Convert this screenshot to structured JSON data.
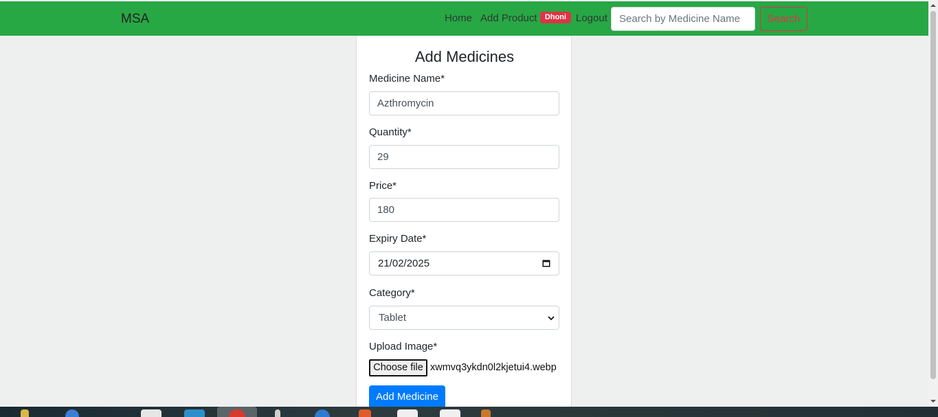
{
  "nav": {
    "brand": "MSA",
    "home": "Home",
    "add_product": "Add Product",
    "user_badge": "Dhoni",
    "logout": "Logout",
    "search_placeholder": "Search by Medicine Name",
    "search_button": "Search"
  },
  "form": {
    "title": "Add Medicines",
    "name_label": "Medicine Name*",
    "name_value": "Azthromycin",
    "quantity_label": "Quantity*",
    "quantity_value": "29",
    "price_label": "Price*",
    "price_value": "180",
    "expiry_label": "Expiry Date*",
    "expiry_value": "21/02/2025",
    "category_label": "Category*",
    "category_value": "Tablet",
    "image_label": "Upload Image*",
    "file_button": "Choose file",
    "file_name": "xwmvq3ykdn0l2kjetui4.webp",
    "submit": "Add Medicine"
  },
  "icons": {
    "calendar": "calendar-icon",
    "select": "chevron-down-icon"
  },
  "colors": {
    "navbar": "#28a745",
    "badge": "#dc3545",
    "search_button": "#dc3545",
    "primary": "#007bff"
  }
}
